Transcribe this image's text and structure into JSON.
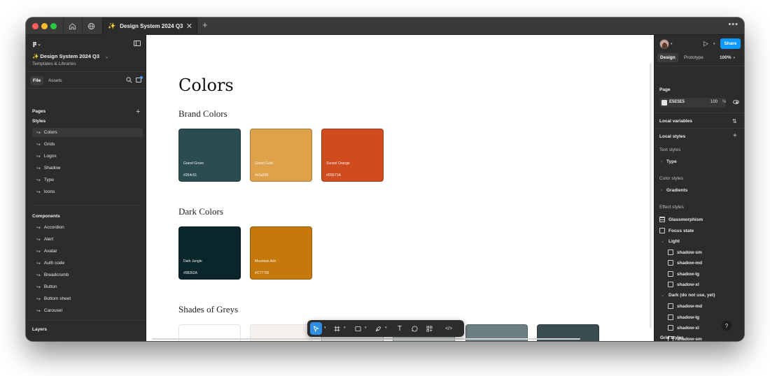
{
  "titlebar": {
    "tab_title": "Design System 2024 Q3",
    "tab_icon": "✨",
    "close_glyph": "✕",
    "new_tab_glyph": "+",
    "more_glyph": "•••"
  },
  "left_panel": {
    "file_title": "✨ Design System 2024 Q3",
    "file_subtitle": "Templates & Libraries",
    "tabs": {
      "file": "File",
      "assets": "Assets"
    },
    "pages_label": "Pages",
    "pages": [
      {
        "label": "Styles",
        "kind": "section"
      },
      {
        "label": "Colors"
      },
      {
        "label": "Grids"
      },
      {
        "label": "Logos"
      },
      {
        "label": "Shadow"
      },
      {
        "label": "Type"
      },
      {
        "label": "Icons"
      }
    ],
    "components_label": "Components",
    "components": [
      {
        "label": "Accordion"
      },
      {
        "label": "Alert"
      },
      {
        "label": "Avatar"
      },
      {
        "label": "Auth code"
      },
      {
        "label": "Breadcrumb"
      },
      {
        "label": "Button"
      },
      {
        "label": "Bottom sheet"
      },
      {
        "label": "Carousel"
      }
    ],
    "layers_label": "Layers"
  },
  "canvas": {
    "title": "Colors",
    "sections": {
      "brand": "Brand Colors",
      "dark": "Dark Colors",
      "greys": "Shades of Greys"
    },
    "brand_swatches": [
      {
        "name": "Grand Green",
        "hex": "#264c51",
        "color": "#2b4d51"
      },
      {
        "name": "Grand Gold",
        "hex": "#e0a246",
        "color": "#dda24a"
      },
      {
        "name": "Sunset Orange",
        "hex": "#D5571A",
        "color": "#cf4c1f"
      }
    ],
    "dark_swatches": [
      {
        "name": "Dark Jungle",
        "hex": "#08262A",
        "color": "#0a262a"
      },
      {
        "name": "Mountain Ash",
        "hex": "#C77700",
        "color": "#c5780b"
      }
    ],
    "grey_swatches": [
      {
        "color": "#ffffff"
      },
      {
        "color": "#f4f1ef"
      },
      {
        "color": "#e3dfdc"
      },
      {
        "color": "#b7bfc1"
      },
      {
        "color": "#6e7f83"
      },
      {
        "color": "#3b4d50"
      }
    ]
  },
  "toolbar": {
    "tools": [
      "move-tool",
      "frame-tool",
      "shape-tool",
      "pen-tool",
      "text-tool",
      "comment-tool",
      "actions-tool",
      "dev-mode-tool"
    ],
    "text_glyph": "T",
    "dev_glyph": "</>"
  },
  "right_panel": {
    "share_label": "Share",
    "tabs": {
      "design": "Design",
      "prototype": "Prototype"
    },
    "zoom": "100%",
    "page_label": "Page",
    "page_fill": {
      "hex": "E5E5E5",
      "opacity": "100",
      "unit": "%"
    },
    "local_variables": "Local variables",
    "local_styles": "Local styles",
    "text_styles_label": "Text styles",
    "text_styles": [
      "Type"
    ],
    "color_styles_label": "Color styles",
    "color_styles": [
      "Gradients"
    ],
    "effect_styles_label": "Effect styles",
    "effects": {
      "glassmorphism": "Glassmorphism",
      "focus": "Focus state",
      "light_group": "Light",
      "light_items": [
        "shadow-sm",
        "shadow-md",
        "shadow-lg",
        "shadow-xl"
      ],
      "dark_group": "Dark (do not use, yet)",
      "dark_items": [
        "shadow-md",
        "shadow-lg",
        "shadow-xl",
        "shadow-sm"
      ]
    },
    "grid_styles_label": "Grid styles",
    "help_glyph": "?"
  }
}
